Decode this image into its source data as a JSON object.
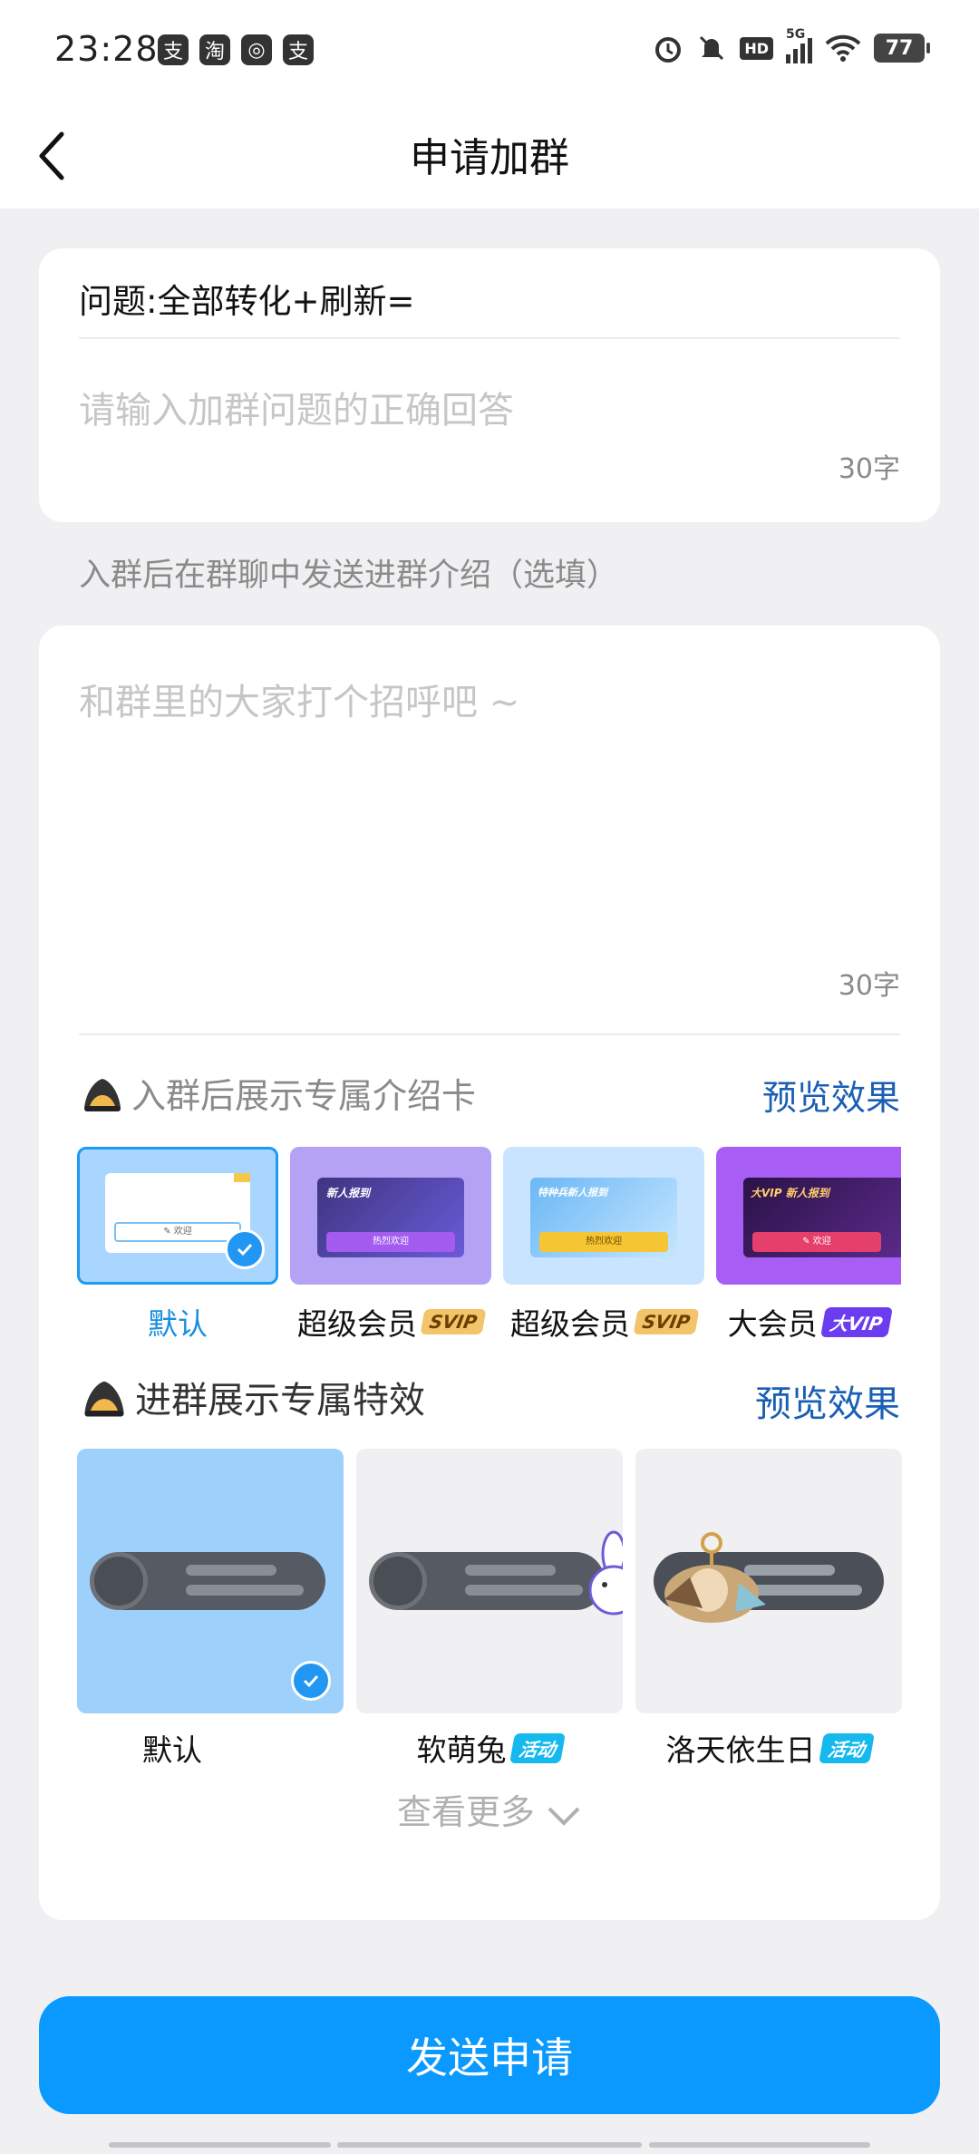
{
  "status_bar": {
    "time": "23:28",
    "notif_icons": [
      "支",
      "淘",
      "◎",
      "支"
    ],
    "network": "5G",
    "hd": "HD",
    "battery": "77"
  },
  "nav": {
    "title": "申请加群"
  },
  "question_card": {
    "question": "问题:全部转化+刷新=",
    "answer_placeholder": "请输入加群问题的正确回答",
    "count": "30字"
  },
  "intro_section_label": "入群后在群聊中发送进群介绍（选填）",
  "intro_card": {
    "placeholder": "和群里的大家打个招呼吧 ~",
    "count": "30字",
    "card_row": {
      "title": "入群后展示专属介绍卡",
      "preview": "预览效果",
      "items": [
        {
          "label": "默认",
          "badge": "",
          "selected": true,
          "inner": "✎ 欢迎"
        },
        {
          "label": "超级会员",
          "badge": "SVIP",
          "selected": false,
          "banner": "新人报到",
          "button": "热烈欢迎"
        },
        {
          "label": "超级会员",
          "badge": "SVIP",
          "selected": false,
          "banner": "特种兵新人报到",
          "button": "热烈欢迎"
        },
        {
          "label": "大会员",
          "badge": "大VIP",
          "selected": false,
          "banner": "大VIP 新人报到",
          "button": "✎ 欢迎"
        }
      ]
    },
    "effect_row": {
      "title": "进群展示专属特效",
      "preview": "预览效果",
      "items": [
        {
          "label": "默认",
          "badge": "",
          "selected": true
        },
        {
          "label": "软萌兔",
          "badge": "活动",
          "selected": false
        },
        {
          "label": "洛天依生日",
          "badge": "活动",
          "selected": false
        }
      ]
    },
    "see_more": "查看更多"
  },
  "send_button": "发送申请",
  "colors": {
    "accent": "#0a99ff",
    "link": "#1a5fb4",
    "page_bg": "#f0f0f3"
  }
}
